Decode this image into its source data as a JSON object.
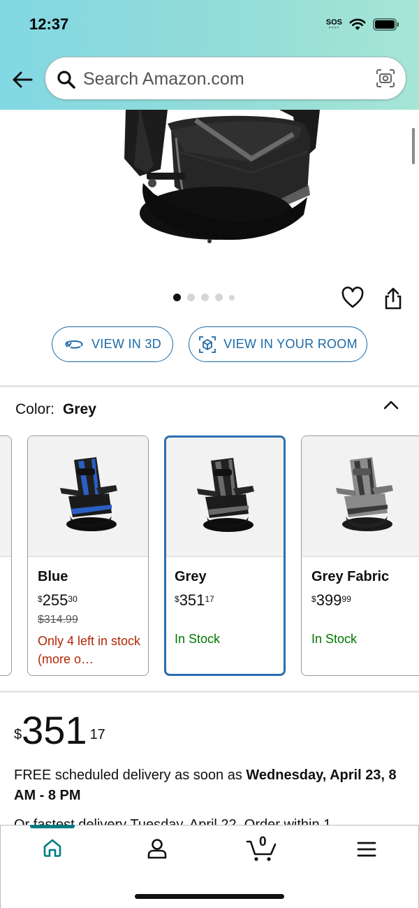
{
  "status_bar": {
    "time": "12:37",
    "sos": "SOS"
  },
  "search": {
    "placeholder": "Search Amazon.com"
  },
  "buttons": {
    "view_3d": "VIEW IN 3D",
    "view_room": "VIEW IN YOUR ROOM"
  },
  "color": {
    "label": "Color:",
    "selected": "Grey"
  },
  "swatches": [
    {
      "name": "Blue",
      "price_whole": "255",
      "price_cents": "30",
      "was": "$314.99",
      "stock": "Only 4 left in stock (more o…"
    },
    {
      "name": "Grey",
      "price_whole": "351",
      "price_cents": "17",
      "stock": "In Stock"
    },
    {
      "name": "Grey Fabric",
      "price_whole": "399",
      "price_cents": "99",
      "stock": "In Stock"
    }
  ],
  "price": {
    "currency": "$",
    "whole": "351",
    "cents": "17"
  },
  "delivery": {
    "prefix": "FREE scheduled delivery as soon as ",
    "date": "Wednesday, April 23, 8 AM - 8 PM",
    "fastest": "Or fastest delivery Tuesday, April 22. Order within 1"
  },
  "cart": {
    "count": "0"
  },
  "colors": {
    "link": "#1b6aa8",
    "accent": "#007c85",
    "in_stock": "#007600",
    "low_stock": "#b12704",
    "selected_border": "#2a6fae"
  }
}
